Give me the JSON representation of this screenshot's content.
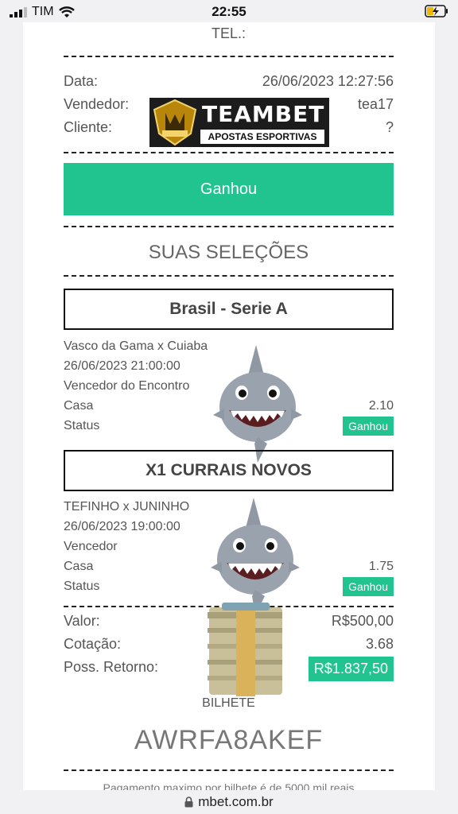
{
  "status_bar": {
    "carrier": "TIM",
    "time": "22:55"
  },
  "receipt": {
    "tel_label": "TEL.:",
    "data_label": "Data:",
    "data_value": "26/06/2023 12:27:56",
    "vendedor_label": "Vendedor:",
    "vendedor_value": "tea17",
    "cliente_label": "Cliente:",
    "cliente_value": "?",
    "status_label": "Ganhou",
    "selections_title": "SUAS SELEÇÕES"
  },
  "logo": {
    "brand": "TEAMBET",
    "tagline": "APOSTAS ESPORTIVAS"
  },
  "selections": [
    {
      "league": "Brasil - Serie A",
      "match": "Vasco da Gama x Cuiaba",
      "datetime": "26/06/2023 21:00:00",
      "market": "Vencedor do Encontro",
      "pick_label": "Casa",
      "odd": "2.10",
      "status_label": "Status",
      "status": "Ganhou"
    },
    {
      "league": "X1 CURRAIS NOVOS",
      "match": "TEFINHO x JUNINHO",
      "datetime": "26/06/2023 19:00:00",
      "market": "Vencedor",
      "pick_label": "Casa",
      "odd": "1.75",
      "status_label": "Status",
      "status": "Ganhou"
    }
  ],
  "totals": {
    "valor_label": "Valor:",
    "valor": "R$500,00",
    "cotacao_label": "Cotação:",
    "cotacao": "3.68",
    "retorno_label": "Poss. Retorno:",
    "retorno": "R$1.837,50"
  },
  "ticket": {
    "label": "BILHETE",
    "code": "AWRFA8AKEF",
    "footer": "Pagamento maximo por bilhete é de 5000 mil reais"
  },
  "url_bar": {
    "url": "mbet.com.br"
  },
  "colors": {
    "accent": "#21c38e"
  }
}
